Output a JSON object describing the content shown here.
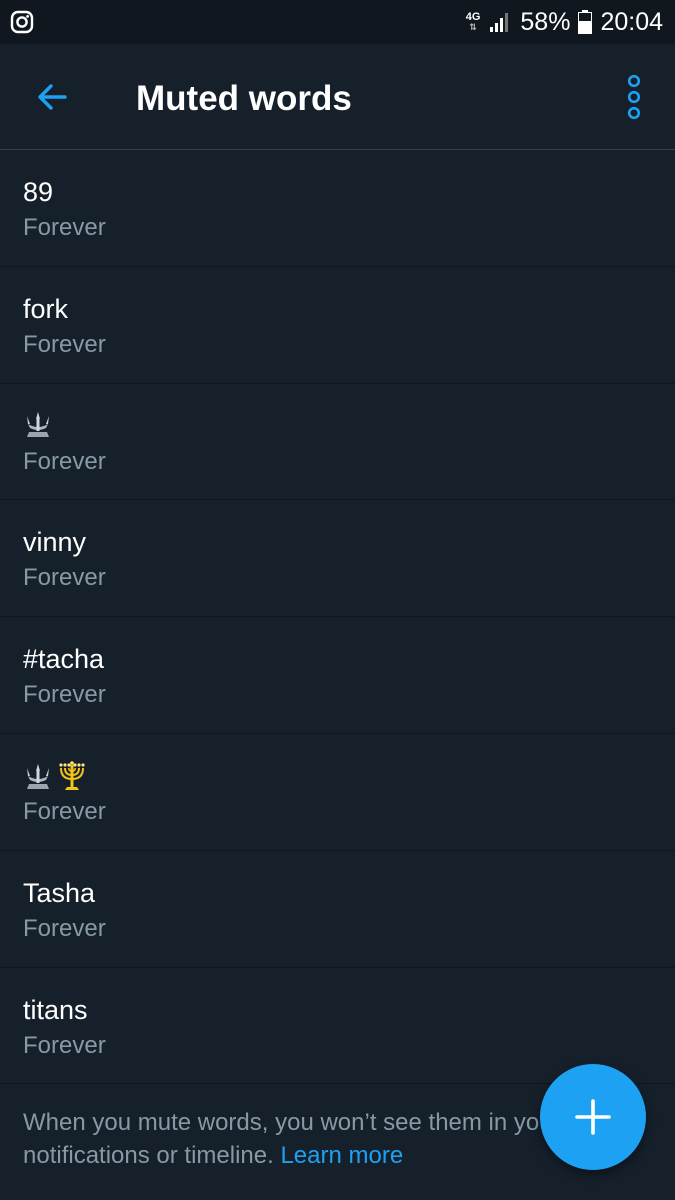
{
  "status_bar": {
    "network": "4G",
    "battery": "58%",
    "time": "20:04",
    "left_icon": "instagram-icon"
  },
  "header": {
    "title": "Muted words",
    "back_icon": "arrow-left-icon",
    "menu_icon": "more-vertical-icon"
  },
  "muted_words": [
    {
      "word": "89",
      "duration": "Forever"
    },
    {
      "word": "fork",
      "duration": "Forever"
    },
    {
      "word": "",
      "duration": "Forever"
    },
    {
      "word": "vinny",
      "duration": "Forever"
    },
    {
      "word": "#tacha",
      "duration": "Forever"
    },
    {
      "word": "",
      "duration": "Forever"
    },
    {
      "word": "Tasha",
      "duration": "Forever"
    },
    {
      "word": "titans",
      "duration": "Forever"
    }
  ],
  "footer": {
    "text": "When you mute words, you won’t see them in your notifications or timeline.",
    "link": "Learn more"
  },
  "fab": {
    "icon": "plus-icon"
  },
  "colors": {
    "background": "#15202b",
    "accent": "#1da1f2",
    "secondary_text": "#8899a6"
  }
}
